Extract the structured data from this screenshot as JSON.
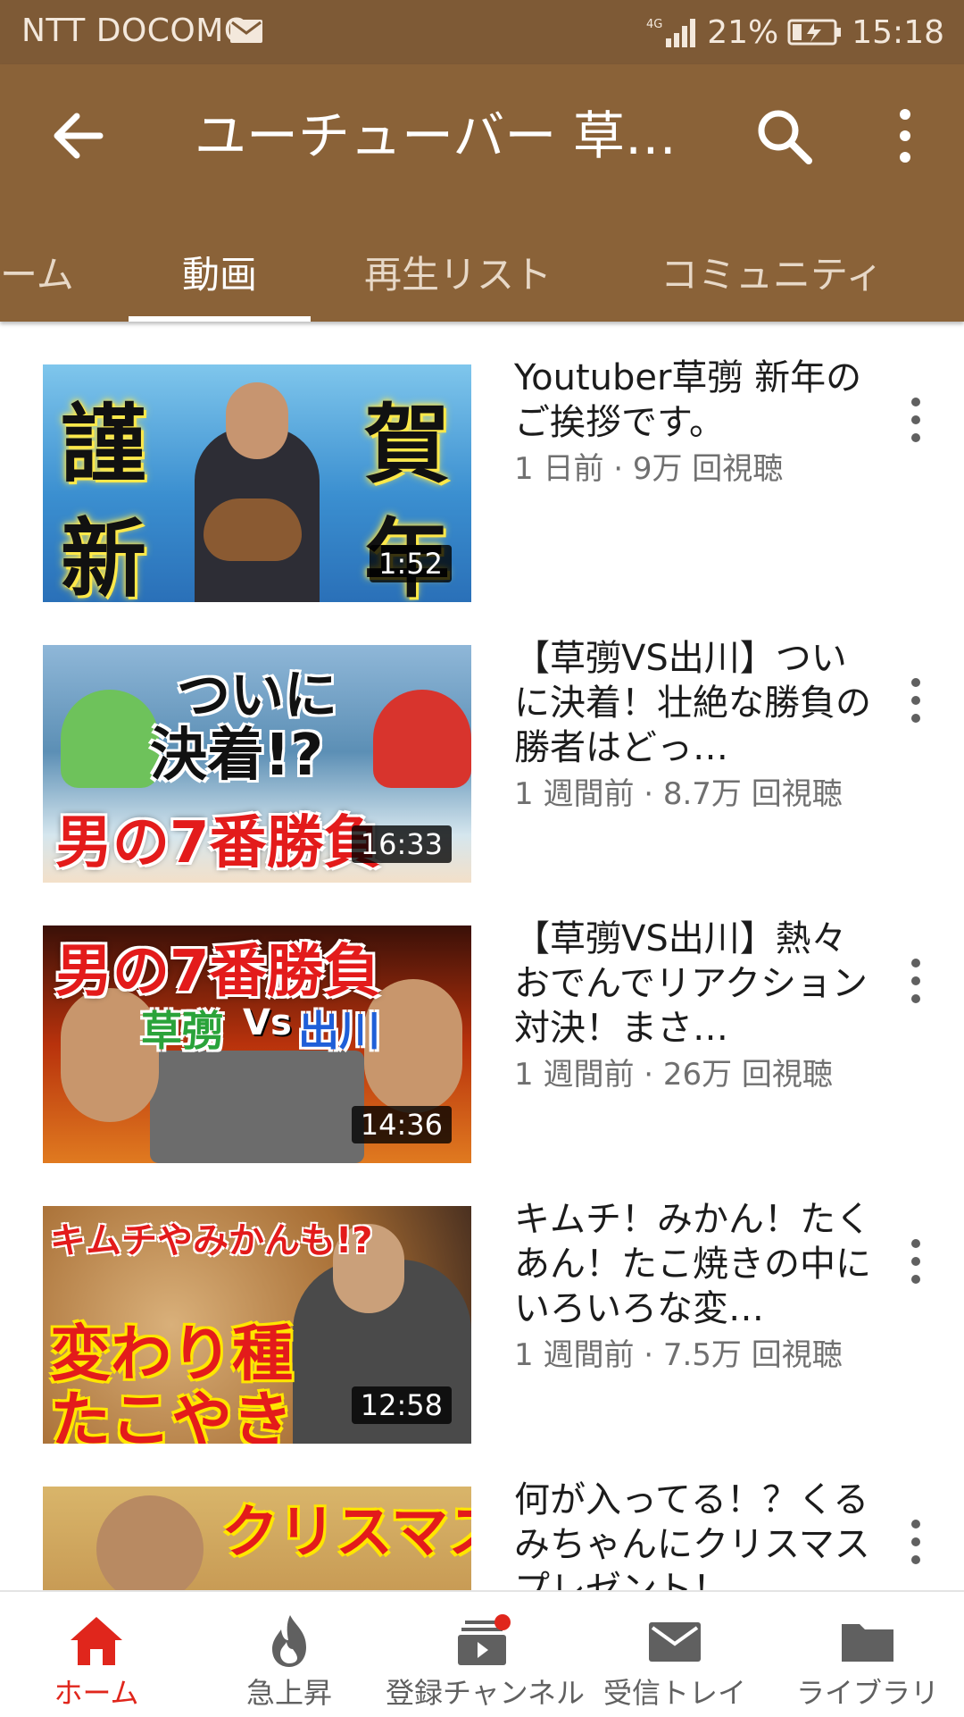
{
  "status_bar": {
    "carrier": "NTT DOCOMO",
    "battery": "21%",
    "time": "15:18",
    "icons": [
      "mail-icon",
      "signal-4g-icon",
      "battery-charging-icon"
    ]
  },
  "app_bar": {
    "title": "ユーチューバー 草…",
    "icons": [
      "back-arrow-icon",
      "search-icon",
      "more-vert-icon"
    ],
    "color": "#8a6238"
  },
  "tabs": [
    {
      "label": "ーム",
      "active": false
    },
    {
      "label": "動画",
      "active": true
    },
    {
      "label": "再生リスト",
      "active": false
    },
    {
      "label": "コミュニティ",
      "active": false
    }
  ],
  "videos": [
    {
      "title": "Youtuber草彅 新年のご挨拶です。",
      "subtitle": "1 日前 · 9万 回視聴",
      "duration": "1:52",
      "thumb_text": [
        "謹",
        "賀",
        "新",
        "年"
      ]
    },
    {
      "title": "【草彅VS出川】ついに決着！壮絶な勝負の勝者はどっ…",
      "subtitle": "1 週間前 · 8.7万 回視聴",
      "duration": "16:33",
      "thumb_text": [
        "ついに",
        "決着!?",
        "男の7番勝負"
      ]
    },
    {
      "title": "【草彅VS出川】熱々おでんでリアクション対決！まさ…",
      "subtitle": "1 週間前 · 26万 回視聴",
      "duration": "14:36",
      "thumb_text": [
        "男の7番勝負",
        "草彅",
        "Vs",
        "出川"
      ]
    },
    {
      "title": "キムチ！みかん！たくあん！たこ焼きの中にいろいろな変…",
      "subtitle": "1 週間前 · 7.5万 回視聴",
      "duration": "12:58",
      "thumb_text": [
        "キムチやみかんも!?",
        "変わり種",
        "たこやき"
      ]
    },
    {
      "title": "何が入ってる！？くるみちゃんにクリスマスプレゼント！",
      "subtitle": "",
      "duration": "",
      "thumb_text": [
        "クリスマス"
      ]
    }
  ],
  "bottom_nav": [
    {
      "label": "ホーム",
      "icon": "home-icon",
      "active": true
    },
    {
      "label": "急上昇",
      "icon": "trending-fire-icon",
      "active": false
    },
    {
      "label": "登録チャンネル",
      "icon": "subscriptions-icon",
      "active": false,
      "badge": true
    },
    {
      "label": "受信トレイ",
      "icon": "inbox-mail-icon",
      "active": false
    },
    {
      "label": "ライブラリ",
      "icon": "library-folder-icon",
      "active": false
    }
  ],
  "colors": {
    "status_bar": "#7e5a36",
    "app_bar": "#8a6238",
    "active_nav": "#e0261c"
  }
}
